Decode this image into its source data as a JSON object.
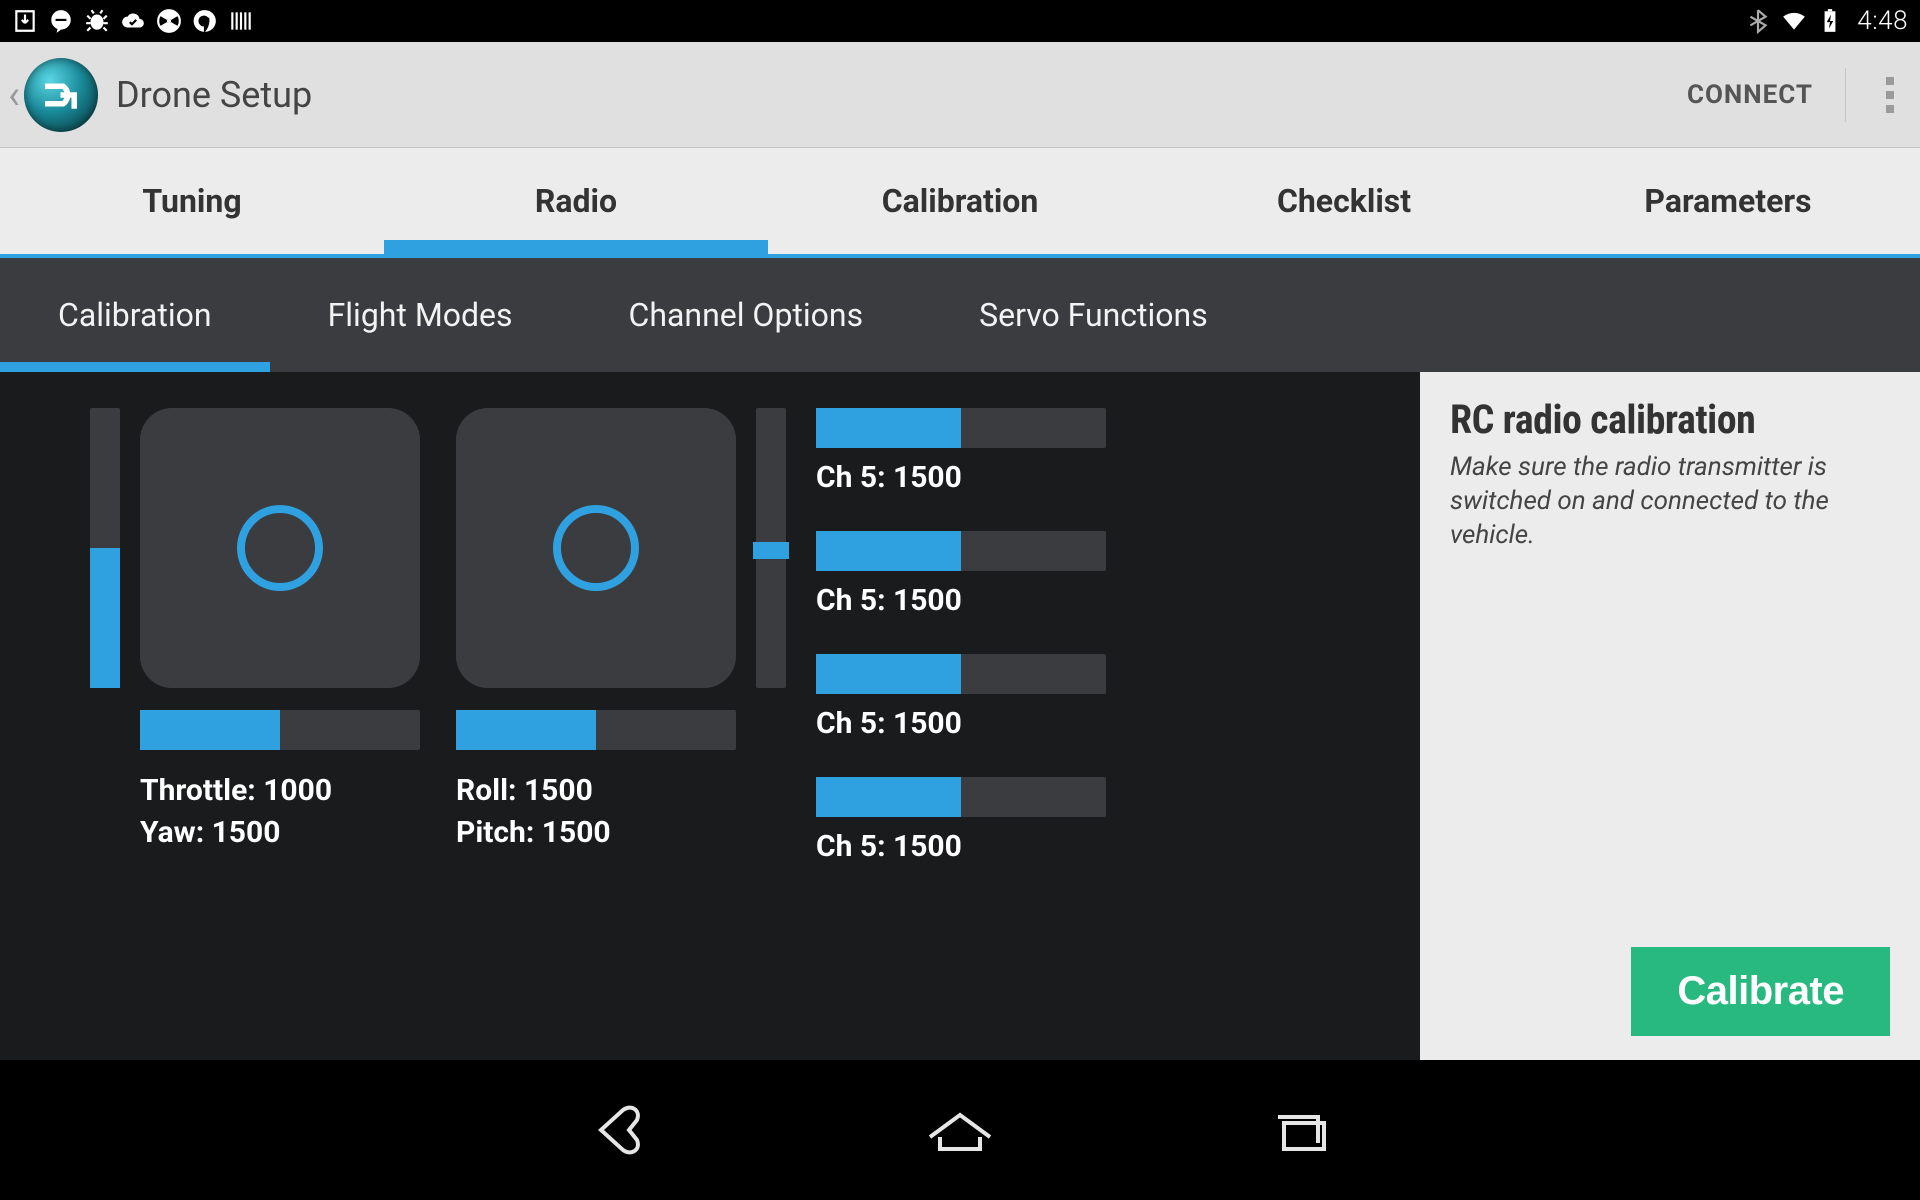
{
  "status": {
    "time": "4:48"
  },
  "header": {
    "title": "Drone Setup",
    "connect": "CONNECT"
  },
  "primaryTabs": [
    {
      "label": "Tuning",
      "active": false
    },
    {
      "label": "Radio",
      "active": true
    },
    {
      "label": "Calibration",
      "active": false
    },
    {
      "label": "Checklist",
      "active": false
    },
    {
      "label": "Parameters",
      "active": false
    }
  ],
  "secondaryTabs": [
    {
      "label": "Calibration",
      "active": true
    },
    {
      "label": "Flight Modes",
      "active": false
    },
    {
      "label": "Channel Options",
      "active": false
    },
    {
      "label": "Servo Functions",
      "active": false
    }
  ],
  "sticks": {
    "left": {
      "throttleLabel": "Throttle: 1000",
      "yawLabel": "Yaw: 1500",
      "vFillPct": 50,
      "hFillPct": 50
    },
    "right": {
      "rollLabel": "Roll: 1500",
      "pitchLabel": "Pitch: 1500",
      "vTopPct": 48,
      "vHeightPct": 6,
      "hFillPct": 50
    }
  },
  "channels": [
    {
      "label": "Ch 5: 1500",
      "fillPct": 50
    },
    {
      "label": "Ch 5: 1500",
      "fillPct": 50
    },
    {
      "label": "Ch 5: 1500",
      "fillPct": 50
    },
    {
      "label": "Ch 5: 1500",
      "fillPct": 50
    }
  ],
  "side": {
    "title": "RC radio calibration",
    "desc": "Make sure the radio transmitter is switched on and connected to the vehicle.",
    "button": "Calibrate"
  }
}
